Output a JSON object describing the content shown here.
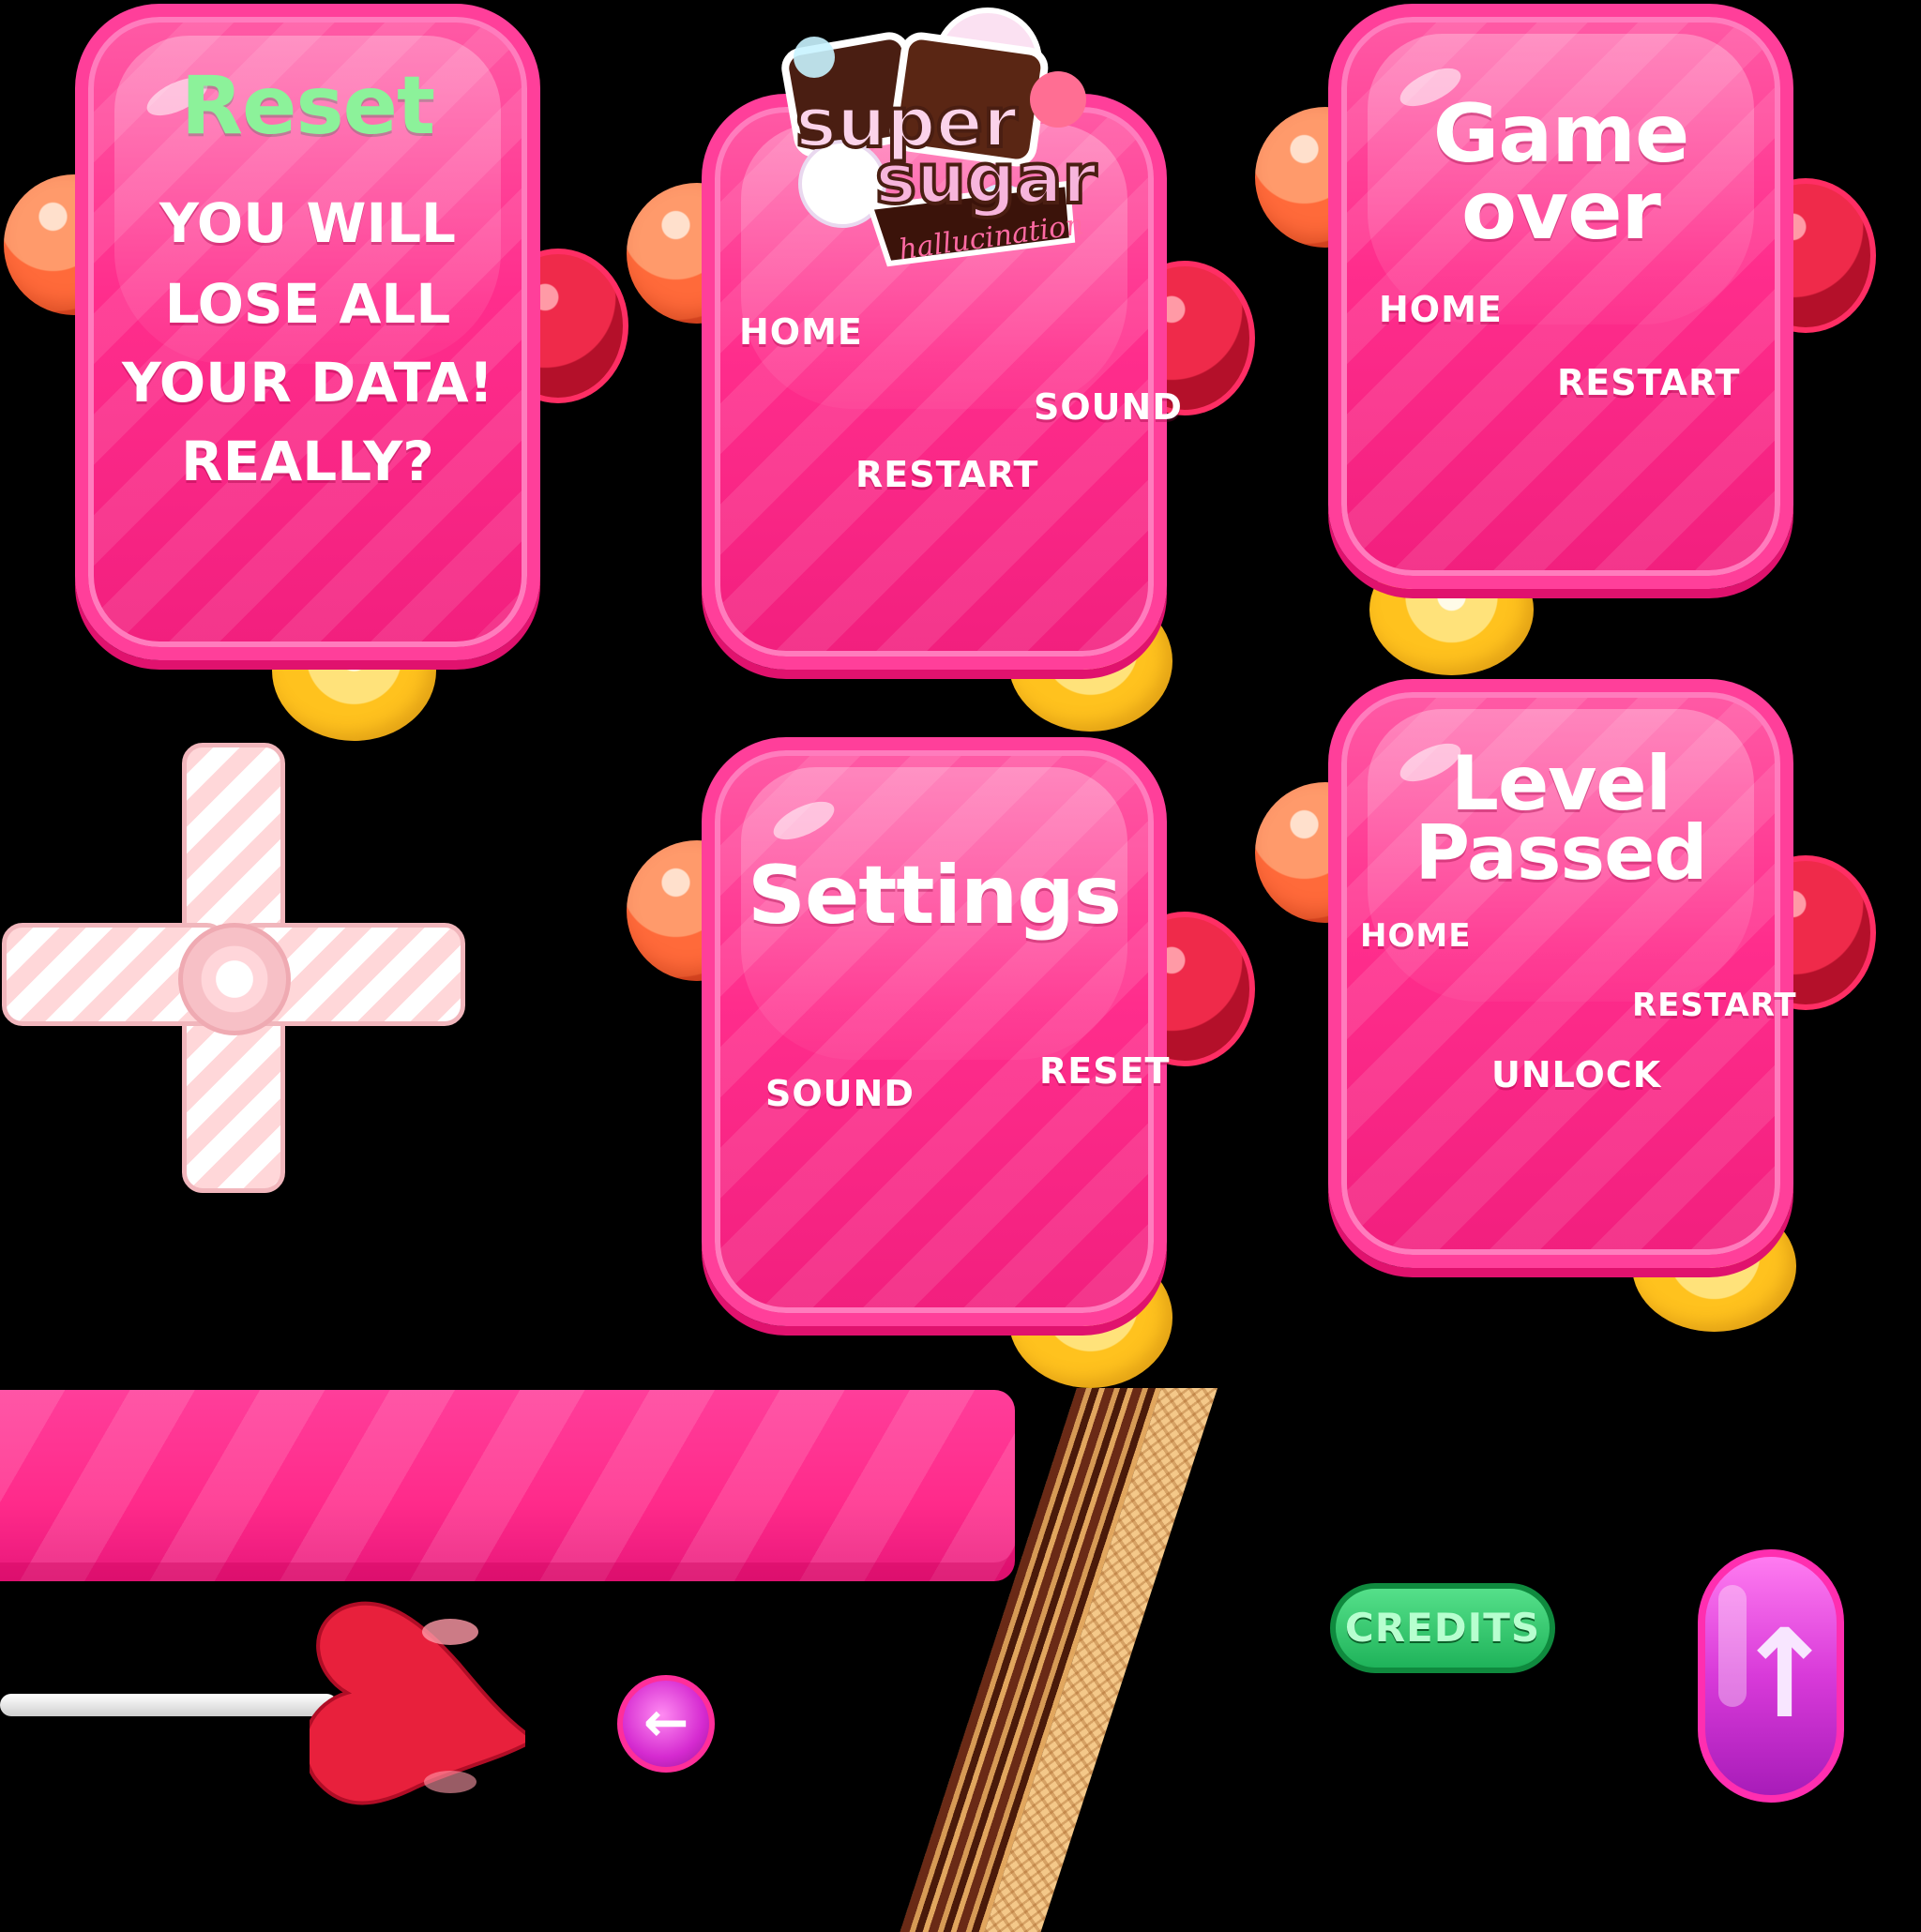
{
  "panels": {
    "reset": {
      "title": "Reset",
      "line1": "YOU WILL",
      "line2": "LOSE ALL",
      "line3": "YOUR DATA!",
      "line4": "REALLY?"
    },
    "pause": {
      "logo_text_1": "super",
      "logo_text_2": "sugar",
      "logo_text_3": "hallucination",
      "home": "HOME",
      "sound": "SOUND",
      "restart": "RESTART"
    },
    "game_over": {
      "title_line1": "Game",
      "title_line2": "over",
      "home": "HOME",
      "restart": "RESTART"
    },
    "settings": {
      "title": "Settings",
      "sound": "SOUND",
      "reset": "RESET"
    },
    "level_passed": {
      "title_line1": "Level",
      "title_line2": "Passed",
      "home": "HOME",
      "restart": "RESTART",
      "unlock": "UNLOCK"
    }
  },
  "buttons": {
    "credits": "CREDITS",
    "up_arrow": "↑",
    "back_arrow": "←"
  },
  "colors": {
    "panel_pink": "#ff2d8c",
    "reset_title_green": "#8cf29a",
    "credits_green": "#1fb35a",
    "up_purple": "#d83ad9"
  },
  "icons": [
    "pinwheel-icon",
    "heart-lollipop-icon",
    "wafer-icon",
    "back-arrow-icon",
    "up-arrow-icon"
  ]
}
